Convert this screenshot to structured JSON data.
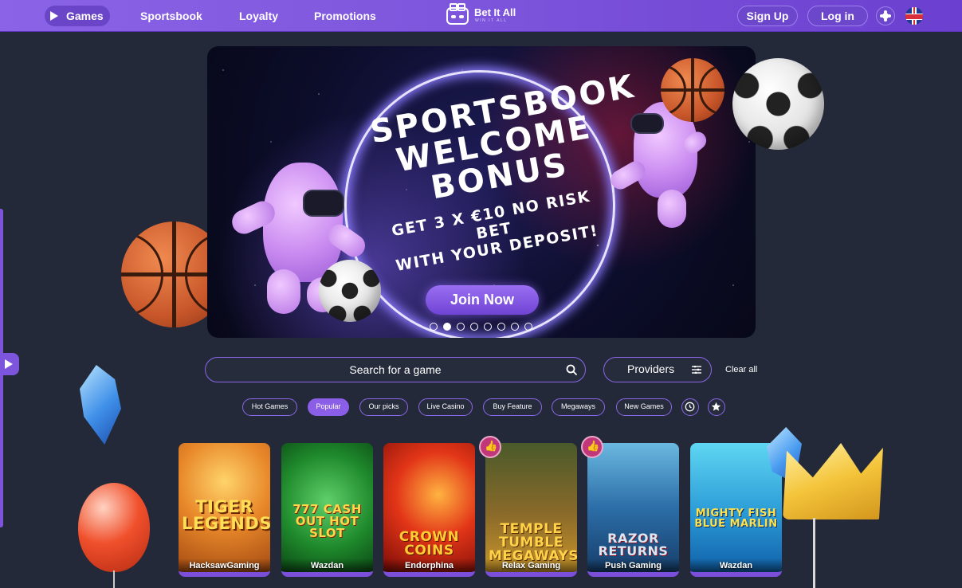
{
  "nav": {
    "games": "Games",
    "sportsbook": "Sportsbook",
    "loyalty": "Loyalty",
    "promotions": "Promotions",
    "brand": "Bet It All",
    "tagline": "WIN IT ALL",
    "signup": "Sign Up",
    "login": "Log in"
  },
  "hero": {
    "title_line1": "SPORTSBOOK",
    "title_line2": "WELCOME BONUS",
    "subtitle_line1": "GET 3 X €10 NO RISK BET",
    "subtitle_line2": "WITH YOUR DEPOSIT!",
    "cta": "Join Now",
    "slides_total": 8,
    "active_slide": 2
  },
  "search": {
    "placeholder": "Search for a game",
    "providers": "Providers",
    "clear_all": "Clear all"
  },
  "filters": {
    "hot": "Hot Games",
    "popular": "Popular",
    "our_picks": "Our picks",
    "live_casino": "Live Casino",
    "buy_feature": "Buy Feature",
    "megaways": "Megaways",
    "new_games": "New Games",
    "active": "Popular"
  },
  "games": [
    {
      "title": "TIGER LEGENDS",
      "provider": "HacksawGaming"
    },
    {
      "title": "777 CASH OUT HOT SLOT",
      "provider": "Wazdan"
    },
    {
      "title": "CROWN COINS",
      "provider": "Endorphina"
    },
    {
      "title": "TEMPLE TUMBLE MEGAWAYS",
      "provider": "Relax Gaming"
    },
    {
      "title": "RAZOR RETURNS",
      "provider": "Push Gaming"
    },
    {
      "title": "MIGHTY FISH BLUE MARLIN",
      "provider": "Wazdan"
    }
  ],
  "icons": {
    "nav_play": "play-icon",
    "theme": "sun-icon",
    "language": "uk-flag-icon",
    "search": "search-icon",
    "filter": "filter-icon",
    "history": "history-icon",
    "favorites": "star-icon",
    "like": "thumbs-up-icon"
  },
  "colors": {
    "accent": "#7d55dc",
    "background": "#232938",
    "like_badge": "#c2377a"
  }
}
